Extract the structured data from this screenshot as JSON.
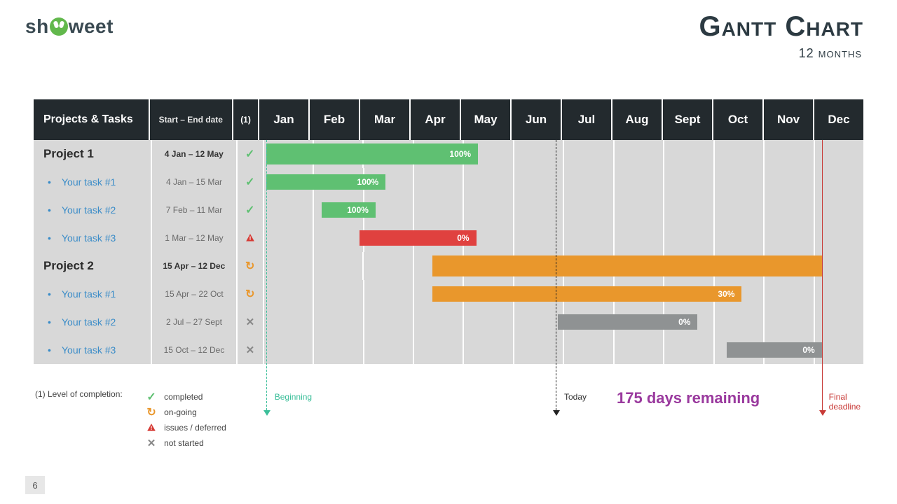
{
  "brand": {
    "pre": "sh",
    "post": "weet"
  },
  "title": "Gantt Chart",
  "subtitle": "12 months",
  "headers": {
    "name": "Projects & Tasks",
    "dates": "Start – End date",
    "status": "(1)",
    "months": [
      "Jan",
      "Feb",
      "Mar",
      "Apr",
      "May",
      "Jun",
      "Jul",
      "Aug",
      "Sept",
      "Oct",
      "Nov",
      "Dec"
    ]
  },
  "colors": {
    "green": "#5fc072",
    "red": "#e0413f",
    "orange": "#e9972c",
    "gray": "#8f9293"
  },
  "status_icons": {
    "completed": "check",
    "on-going": "going",
    "issues / deferred": "issue",
    "not started": "not"
  },
  "rows": [
    {
      "type": "group",
      "name": "Project 1",
      "dates": "4 Jan – 12 May",
      "status": "completed",
      "bar": {
        "color": "green",
        "label": "100%",
        "lpct": 0.8,
        "wpct": 36.0,
        "thick": true
      }
    },
    {
      "type": "task",
      "name": "Your task #1",
      "dates": "4 Jan – 15 Mar",
      "status": "completed",
      "bar": {
        "color": "green",
        "label": "100%",
        "lpct": 0.8,
        "wpct": 20.3
      }
    },
    {
      "type": "task",
      "name": "Your task #2",
      "dates": "7 Feb – 11 Mar",
      "status": "completed",
      "bar": {
        "color": "green",
        "label": "100%",
        "lpct": 10.2,
        "wpct": 9.2
      }
    },
    {
      "type": "task",
      "name": "Your task #3",
      "dates": "1 Mar – 12 May",
      "status": "issues / deferred",
      "bar": {
        "color": "red",
        "label": "0%",
        "lpct": 16.7,
        "wpct": 19.8
      }
    },
    {
      "type": "group",
      "name": "Project 2",
      "dates": "15 Apr – 12 Dec",
      "status": "on-going",
      "bar": {
        "color": "orange",
        "label": "",
        "lpct": 29.0,
        "wpct": 66.2,
        "thick": true
      }
    },
    {
      "type": "task",
      "name": "Your task #1",
      "dates": "15 Apr – 22 Oct",
      "status": "on-going",
      "bar": {
        "color": "orange",
        "label": "30%",
        "lpct": 29.0,
        "wpct": 52.6
      }
    },
    {
      "type": "task",
      "name": "Your task #2",
      "dates": "2 Jul – 27 Sept",
      "status": "not started",
      "bar": {
        "color": "gray",
        "label": "0%",
        "lpct": 50.3,
        "wpct": 23.8
      }
    },
    {
      "type": "task",
      "name": "Your task #3",
      "dates": "15 Oct – 12 Dec",
      "status": "not started",
      "bar": {
        "color": "gray",
        "label": "0%",
        "lpct": 79.0,
        "wpct": 16.2
      }
    }
  ],
  "markers": {
    "beginning": {
      "pct": 0.8,
      "label": "Beginning"
    },
    "today": {
      "pct": 50.0,
      "label": "Today"
    },
    "deadline": {
      "pct": 95.2,
      "label": "Final\ndeadline"
    }
  },
  "legend": {
    "lead": "(1) Level of completion:",
    "items": [
      "completed",
      "on-going",
      "issues / deferred",
      "not started"
    ]
  },
  "remaining": "175 days remaining",
  "page": "6",
  "chart_data": {
    "type": "gantt",
    "title": "Gantt Chart — 12 months",
    "x_categories": [
      "Jan",
      "Feb",
      "Mar",
      "Apr",
      "May",
      "Jun",
      "Jul",
      "Aug",
      "Sept",
      "Oct",
      "Nov",
      "Dec"
    ],
    "markers": {
      "beginning": "4 Jan",
      "today": "1 Jul",
      "final_deadline": "12 Dec"
    },
    "days_remaining": 175,
    "tasks": [
      {
        "group": "Project 1",
        "name": "Project 1",
        "start": "4 Jan",
        "end": "12 May",
        "progress_pct": 100,
        "status": "completed"
      },
      {
        "group": "Project 1",
        "name": "Your task #1",
        "start": "4 Jan",
        "end": "15 Mar",
        "progress_pct": 100,
        "status": "completed"
      },
      {
        "group": "Project 1",
        "name": "Your task #2",
        "start": "7 Feb",
        "end": "11 Mar",
        "progress_pct": 100,
        "status": "completed"
      },
      {
        "group": "Project 1",
        "name": "Your task #3",
        "start": "1 Mar",
        "end": "12 May",
        "progress_pct": 0,
        "status": "issues / deferred"
      },
      {
        "group": "Project 2",
        "name": "Project 2",
        "start": "15 Apr",
        "end": "12 Dec",
        "progress_pct": null,
        "status": "on-going"
      },
      {
        "group": "Project 2",
        "name": "Your task #1",
        "start": "15 Apr",
        "end": "22 Oct",
        "progress_pct": 30,
        "status": "on-going"
      },
      {
        "group": "Project 2",
        "name": "Your task #2",
        "start": "2 Jul",
        "end": "27 Sept",
        "progress_pct": 0,
        "status": "not started"
      },
      {
        "group": "Project 2",
        "name": "Your task #3",
        "start": "15 Oct",
        "end": "12 Dec",
        "progress_pct": 0,
        "status": "not started"
      }
    ]
  }
}
